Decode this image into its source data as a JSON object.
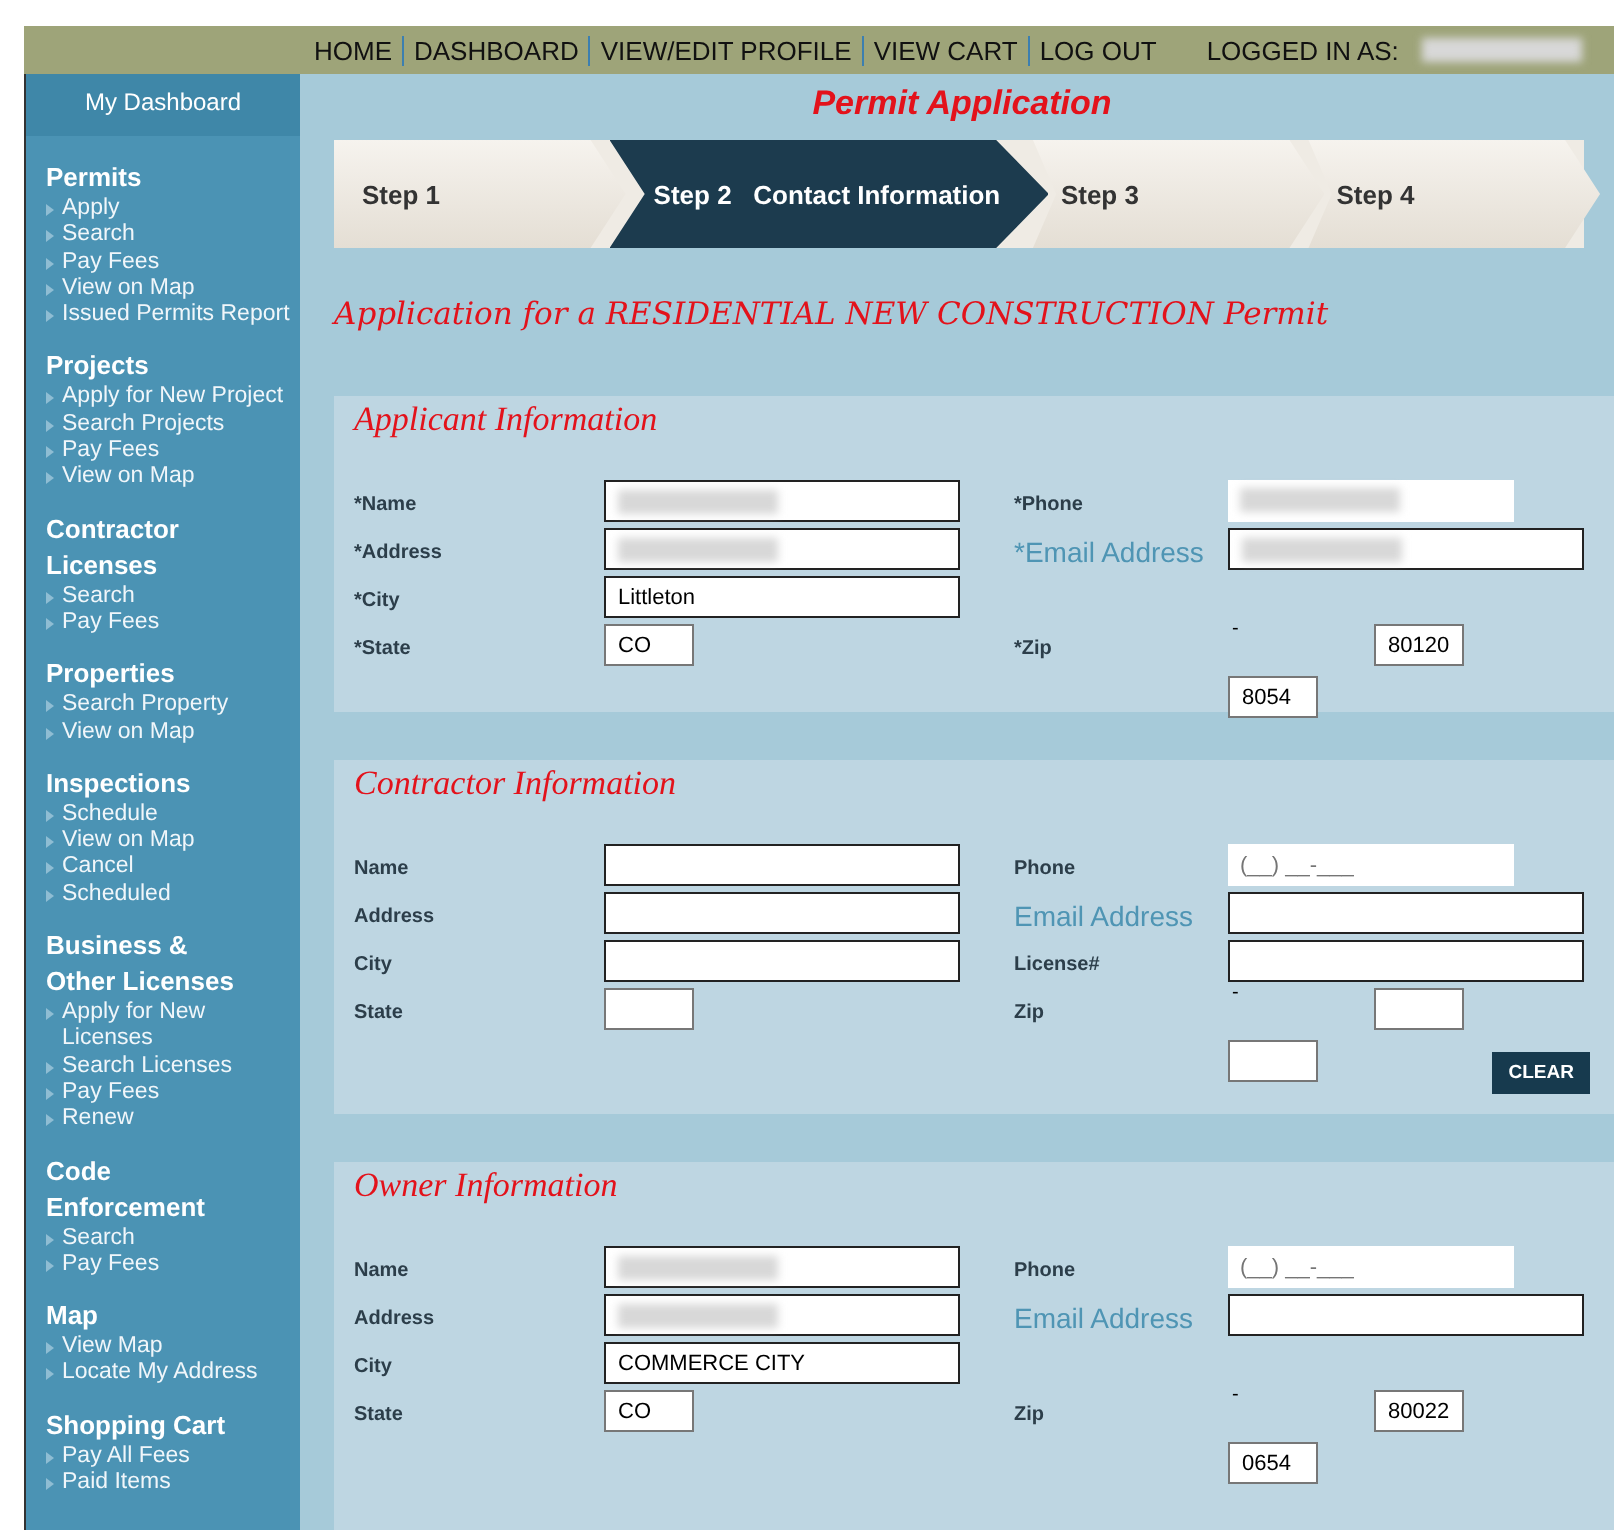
{
  "nav": {
    "links": [
      "HOME",
      "DASHBOARD",
      "VIEW/EDIT PROFILE",
      "VIEW CART",
      "LOG OUT"
    ],
    "logged_in_label": "LOGGED IN AS:",
    "logged_in_redacted": true
  },
  "sidebar": {
    "header": "My Dashboard",
    "groups": [
      {
        "heading": "Permits",
        "items": [
          "Apply",
          "Search",
          "Pay Fees",
          "View on Map",
          "Issued Permits Report"
        ]
      },
      {
        "heading": "Projects",
        "items": [
          "Apply for New Project",
          "Search Projects",
          "Pay Fees",
          "View on Map"
        ]
      },
      {
        "heading": "Contractor Licenses",
        "items": [
          "Search",
          "Pay Fees"
        ]
      },
      {
        "heading": "Properties",
        "items": [
          "Search Property",
          "View on Map"
        ]
      },
      {
        "heading": "Inspections",
        "items": [
          "Schedule",
          "View on Map",
          "Cancel",
          "Scheduled"
        ]
      },
      {
        "heading": "Business & Other Licenses",
        "items": [
          "Apply for New Licenses",
          "Search Licenses",
          "Pay Fees",
          "Renew"
        ]
      },
      {
        "heading": "Code Enforcement",
        "items": [
          "Search",
          "Pay Fees"
        ]
      },
      {
        "heading": "Map",
        "items": [
          "View Map",
          "Locate My Address"
        ]
      },
      {
        "heading": "Shopping Cart",
        "items": [
          "Pay All Fees",
          "Paid Items"
        ]
      }
    ]
  },
  "page_title": "Permit Application",
  "steps": [
    {
      "label": "Step 1",
      "selected": false
    },
    {
      "label": "Step 2",
      "detail": "Contact Information",
      "selected": true
    },
    {
      "label": "Step 3",
      "selected": false
    },
    {
      "label": "Step 4",
      "selected": false
    }
  ],
  "heading": "Application for a RESIDENTIAL NEW CONSTRUCTION Permit",
  "sections": [
    {
      "title": "Applicant Information",
      "left": [
        {
          "kind": "text",
          "label": "*Name",
          "redacted": true
        },
        {
          "kind": "text",
          "label": "*Address",
          "redacted": true
        },
        {
          "kind": "text",
          "label": "*City",
          "value": "Littleton"
        },
        {
          "kind": "short",
          "label": "*State",
          "value": "CO"
        }
      ],
      "right": [
        {
          "kind": "phone",
          "label": "*Phone",
          "redacted": true
        },
        {
          "kind": "email",
          "label": "*Email Address",
          "redacted": true
        },
        {
          "kind": "blank"
        },
        {
          "kind": "zip",
          "label": "*Zip",
          "dash": "-",
          "values": [
            "80120",
            "8054"
          ]
        }
      ]
    },
    {
      "title": "Contractor Information",
      "left": [
        {
          "kind": "text",
          "label": "Name"
        },
        {
          "kind": "text",
          "label": "Address"
        },
        {
          "kind": "text",
          "label": "City"
        },
        {
          "kind": "short",
          "label": "State"
        }
      ],
      "right": [
        {
          "kind": "phone",
          "label": "Phone",
          "placeholder": "(__) __-___"
        },
        {
          "kind": "email",
          "label": "Email Address"
        },
        {
          "kind": "text",
          "label": "License#"
        },
        {
          "kind": "zip",
          "label": "Zip",
          "dash": "-"
        }
      ],
      "button": "CLEAR"
    },
    {
      "title": "Owner Information",
      "left": [
        {
          "kind": "text",
          "label": "Name",
          "redacted": true
        },
        {
          "kind": "text",
          "label": "Address",
          "redacted": true
        },
        {
          "kind": "text",
          "label": "City",
          "value": "COMMERCE CITY"
        },
        {
          "kind": "short",
          "label": "State",
          "value": "CO"
        }
      ],
      "right": [
        {
          "kind": "phone",
          "label": "Phone",
          "placeholder": "(__) __-___"
        },
        {
          "kind": "email",
          "label": "Email Address"
        },
        {
          "kind": "blank"
        },
        {
          "kind": "zip",
          "label": "Zip",
          "dash": "-",
          "values": [
            "80022",
            "0654"
          ]
        }
      ]
    }
  ]
}
